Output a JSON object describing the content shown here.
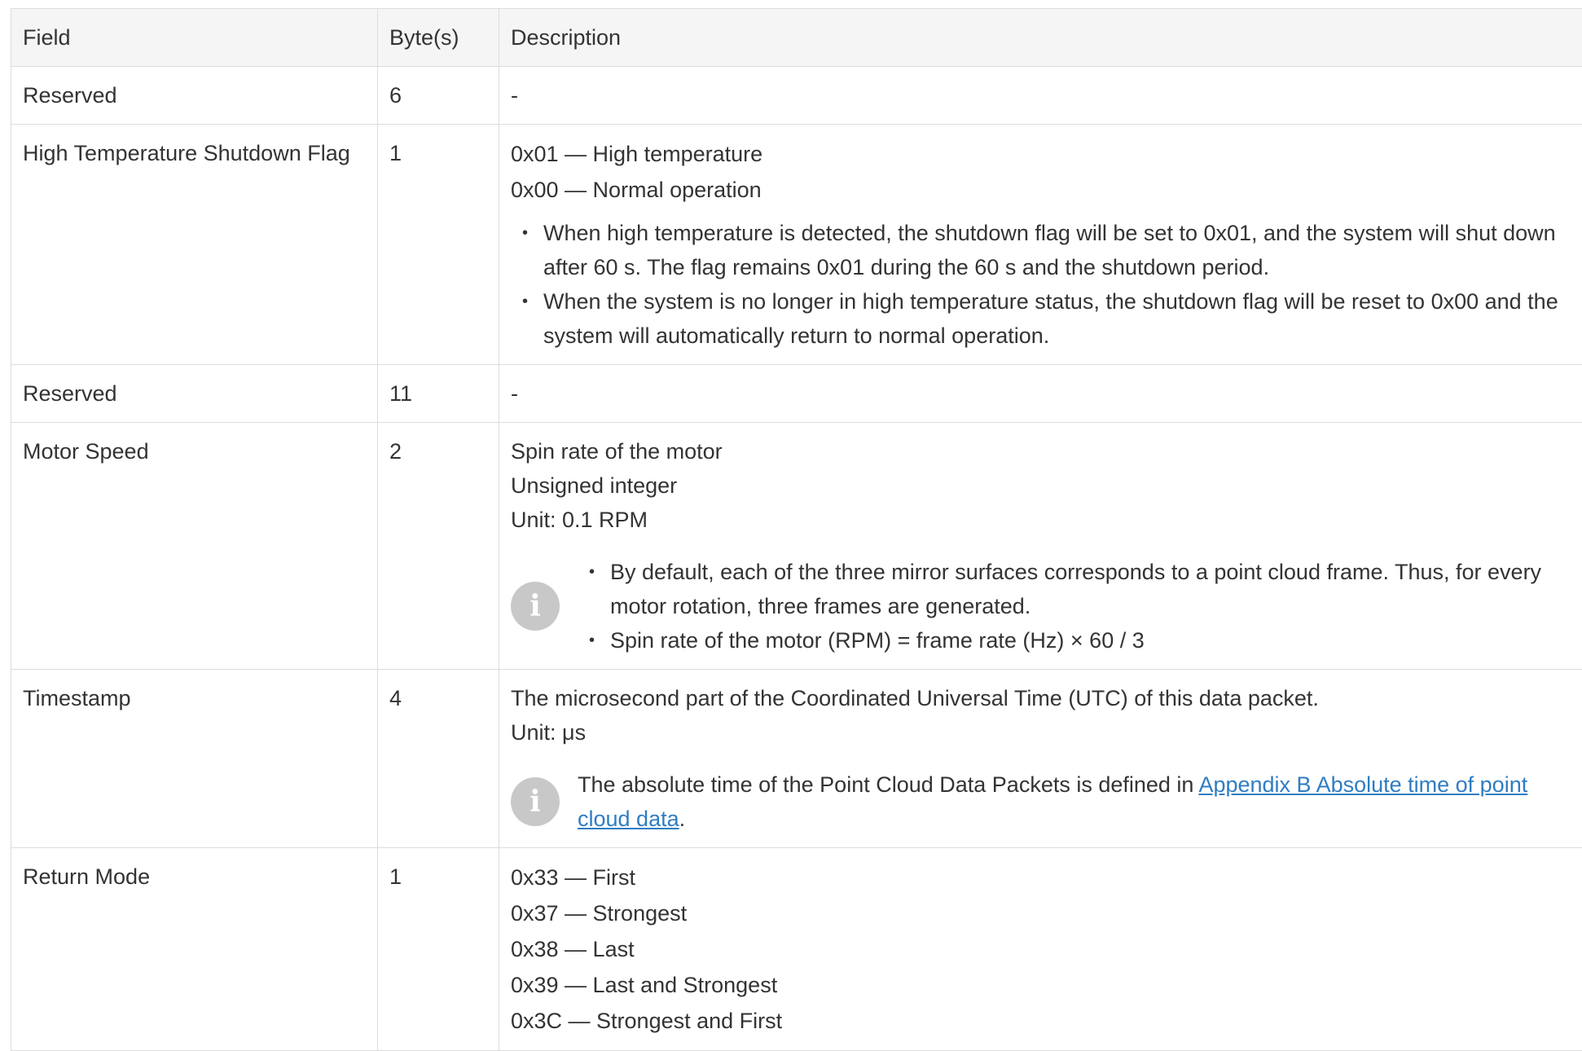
{
  "header": {
    "field": "Field",
    "bytes": "Byte(s)",
    "description": "Description"
  },
  "rows": {
    "reserved1": {
      "field": "Reserved",
      "bytes": "6",
      "description": "-"
    },
    "shutdown": {
      "field": "High Temperature Shutdown Flag",
      "bytes": "1",
      "lines": [
        "0x01 — High temperature",
        "0x00 — Normal operation"
      ],
      "bullets": [
        "When high temperature is detected, the shutdown flag will be set to 0x01, and the system will shut down after 60 s. The flag remains 0x01 during the 60 s and the shutdown period.",
        "When the system is no longer in high temperature status, the shutdown flag will be reset to 0x00 and the system will automatically return to normal operation."
      ]
    },
    "reserved2": {
      "field": "Reserved",
      "bytes": "11",
      "description": "-"
    },
    "motor": {
      "field": "Motor Speed",
      "bytes": "2",
      "lines": [
        "Spin rate of the motor",
        "Unsigned integer",
        "Unit: 0.1 RPM"
      ],
      "note_bullets": [
        "By default, each of the three mirror surfaces corresponds to a point cloud frame. Thus, for every motor rotation, three frames are generated.",
        "Spin rate of the motor (RPM) = frame rate (Hz) × 60 / 3"
      ]
    },
    "timestamp": {
      "field": "Timestamp",
      "bytes": "4",
      "lines": [
        "The microsecond part of the Coordinated Universal Time (UTC) of this data packet.",
        "Unit: μs"
      ],
      "note_text": "The absolute time of the Point Cloud Data Packets is defined in ",
      "note_link": "Appendix B Absolute time of point cloud data",
      "note_suffix": "."
    },
    "return_mode": {
      "field": "Return Mode",
      "bytes": "1",
      "lines": [
        "0x33 — First",
        "0x37 — Strongest",
        "0x38 — Last",
        "0x39 — Last and Strongest",
        "0x3C — Strongest and First"
      ]
    }
  },
  "icons": {
    "note": "info-icon",
    "note_glyph": "i"
  }
}
